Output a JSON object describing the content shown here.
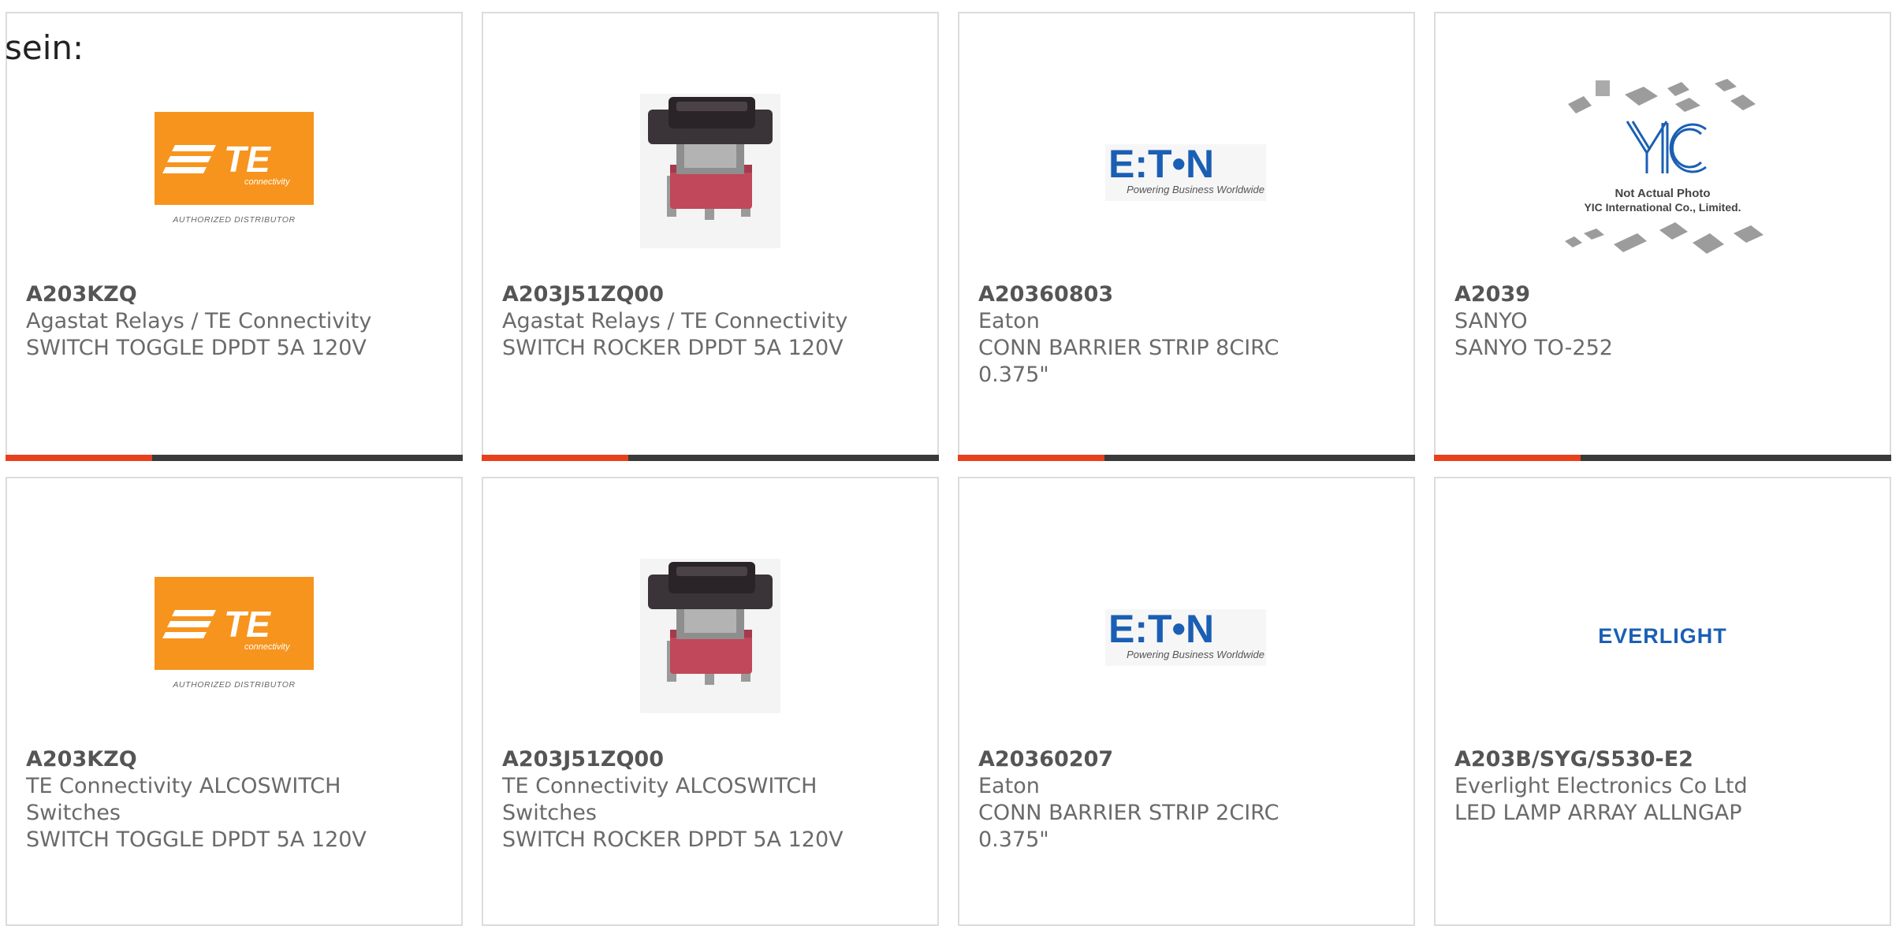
{
  "intro_text": "sein:",
  "colors": {
    "accent": "#e8401c",
    "bar_track": "#3a3a3a",
    "te_orange": "#f7941d",
    "eaton_blue": "#1a5fb4"
  },
  "products": [
    {
      "part_number": "A203KZQ",
      "manufacturer": "Agastat Relays / TE Connectivity",
      "description": "SWITCH TOGGLE DPDT 5A 120V",
      "image": "te-logo",
      "image_caption": "AUTHORIZED DISTRIBUTOR",
      "progress": 0.32,
      "has_bar": true
    },
    {
      "part_number": "A203J51ZQ00",
      "manufacturer": "Agastat Relays / TE Connectivity",
      "description": "SWITCH ROCKER DPDT 5A 120V",
      "image": "rocker-switch",
      "progress": 0.32,
      "has_bar": true
    },
    {
      "part_number": "A20360803",
      "manufacturer": "Eaton",
      "description": "CONN BARRIER STRIP 8CIRC 0.375\"",
      "image": "eaton-logo",
      "image_tagline": "Powering Business Worldwide",
      "progress": 0.32,
      "has_bar": true
    },
    {
      "part_number": "A2039",
      "manufacturer": "SANYO",
      "description": "SANYO TO-252",
      "image": "yic-placeholder",
      "image_caption": "Not Actual Photo",
      "image_company": "YIC International Co., Limited.",
      "progress": 0.32,
      "has_bar": true
    },
    {
      "part_number": "A203KZQ",
      "manufacturer": "TE Connectivity ALCOSWITCH Switches",
      "description": "SWITCH TOGGLE DPDT 5A 120V",
      "image": "te-logo",
      "image_caption": "AUTHORIZED DISTRIBUTOR",
      "has_bar": false
    },
    {
      "part_number": "A203J51ZQ00",
      "manufacturer": "TE Connectivity ALCOSWITCH Switches",
      "description": "SWITCH ROCKER DPDT 5A 120V",
      "image": "rocker-switch",
      "has_bar": false
    },
    {
      "part_number": "A20360207",
      "manufacturer": "Eaton",
      "description": "CONN BARRIER STRIP 2CIRC 0.375\"",
      "image": "eaton-logo",
      "image_tagline": "Powering Business Worldwide",
      "has_bar": false
    },
    {
      "part_number": "A203B/SYG/S530-E2",
      "manufacturer": "Everlight Electronics Co Ltd",
      "description": "LED LAMP ARRAY ALLNGAP",
      "image": "everlight-logo",
      "has_bar": false
    }
  ]
}
